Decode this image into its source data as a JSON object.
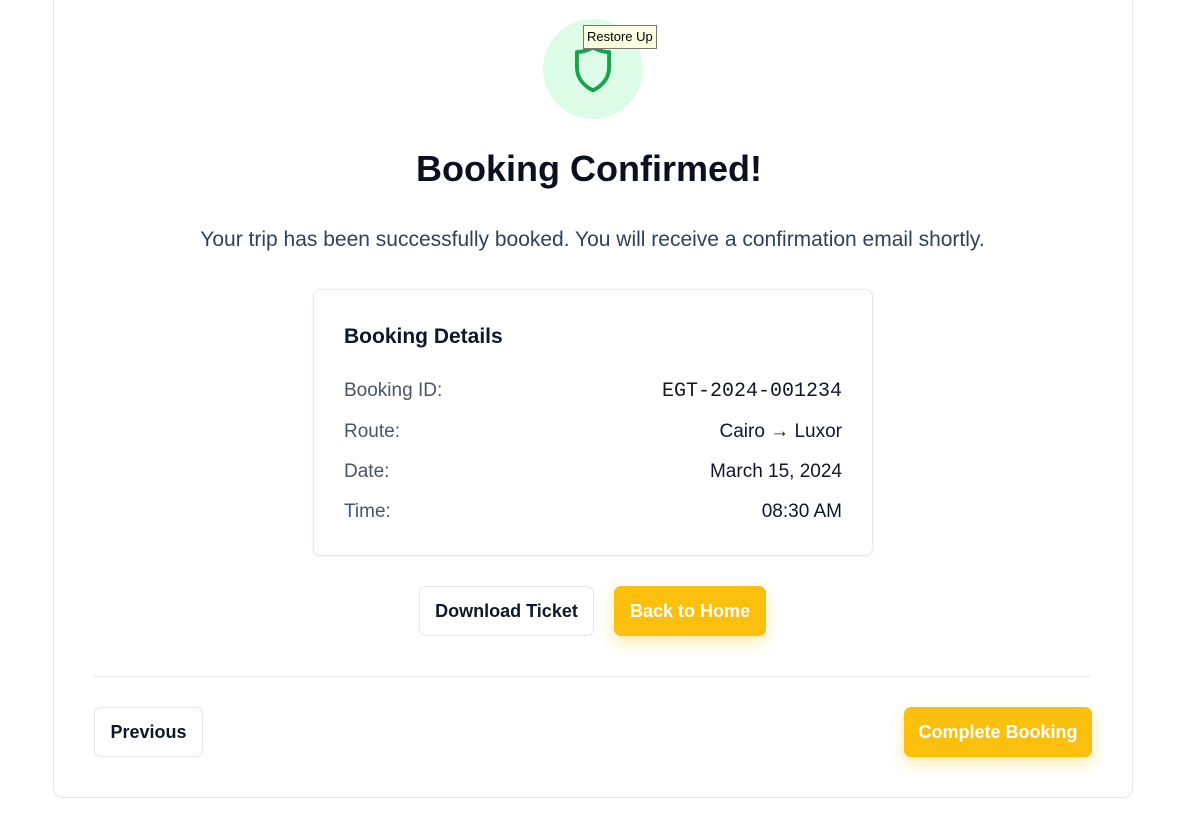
{
  "tooltip": "Restore Up",
  "icon": "shield-icon",
  "colors": {
    "accent": "#fbbf0e",
    "success": "#16a34a",
    "success_bg": "#dcfce7"
  },
  "header": {
    "title": "Booking Confirmed!",
    "subtitle": "Your trip has been successfully booked. You will receive a confirmation email shortly."
  },
  "details": {
    "heading": "Booking Details",
    "rows": [
      {
        "label": "Booking ID:",
        "value": "EGT-2024-001234"
      },
      {
        "label": "Route:",
        "value": "Cairo → Luxor"
      },
      {
        "label": "Date:",
        "value": "March 15, 2024"
      },
      {
        "label": "Time:",
        "value": "08:30 AM"
      }
    ]
  },
  "actions": {
    "download": "Download Ticket",
    "home": "Back to Home"
  },
  "footer": {
    "previous": "Previous",
    "complete": "Complete Booking"
  }
}
